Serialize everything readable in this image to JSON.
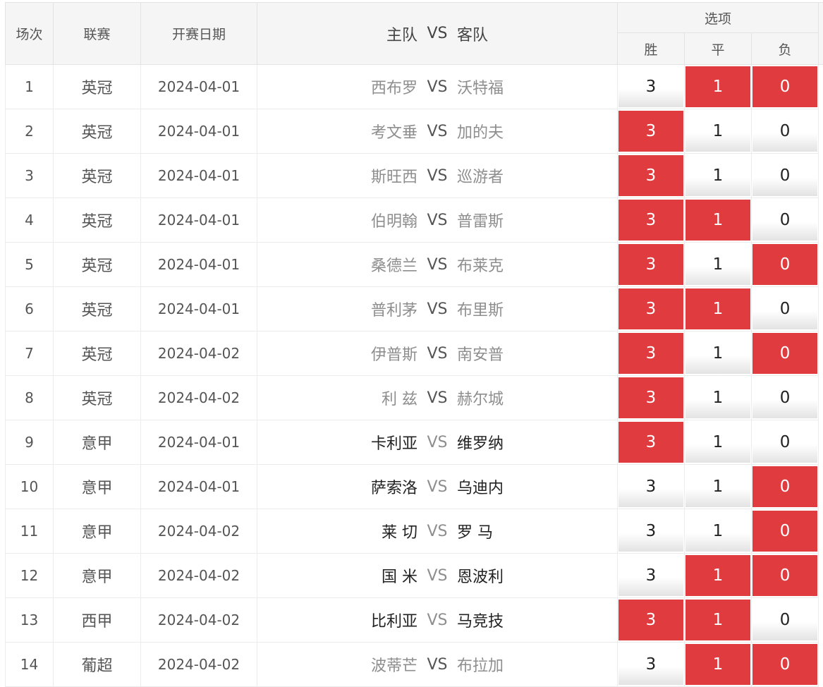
{
  "header": {
    "round": "场次",
    "league": "联赛",
    "date": "开赛日期",
    "home": "主队",
    "vs": "VS",
    "away": "客队",
    "options": "选项",
    "win": "胜",
    "draw": "平",
    "lose": "负"
  },
  "colors": {
    "selected": "#e03b3f",
    "muted_team": "#8e8e8e",
    "strong_team": "#222222"
  },
  "rows": [
    {
      "no": "1",
      "league": "英冠",
      "date": "2024-04-01",
      "home": "西布罗",
      "away": "沃特福",
      "home_style": "muted",
      "away_style": "muted",
      "win": "3",
      "draw": "1",
      "lose": "0",
      "win_sel": false,
      "draw_sel": true,
      "lose_sel": true
    },
    {
      "no": "2",
      "league": "英冠",
      "date": "2024-04-01",
      "home": "考文垂",
      "away": "加的夫",
      "home_style": "muted",
      "away_style": "muted",
      "win": "3",
      "draw": "1",
      "lose": "0",
      "win_sel": true,
      "draw_sel": false,
      "lose_sel": false
    },
    {
      "no": "3",
      "league": "英冠",
      "date": "2024-04-01",
      "home": "斯旺西",
      "away": "巡游者",
      "home_style": "muted",
      "away_style": "muted",
      "win": "3",
      "draw": "1",
      "lose": "0",
      "win_sel": true,
      "draw_sel": false,
      "lose_sel": false
    },
    {
      "no": "4",
      "league": "英冠",
      "date": "2024-04-01",
      "home": "伯明翰",
      "away": "普雷斯",
      "home_style": "muted",
      "away_style": "muted",
      "win": "3",
      "draw": "1",
      "lose": "0",
      "win_sel": true,
      "draw_sel": true,
      "lose_sel": false
    },
    {
      "no": "5",
      "league": "英冠",
      "date": "2024-04-01",
      "home": "桑德兰",
      "away": "布莱克",
      "home_style": "muted",
      "away_style": "muted",
      "win": "3",
      "draw": "1",
      "lose": "0",
      "win_sel": true,
      "draw_sel": false,
      "lose_sel": true
    },
    {
      "no": "6",
      "league": "英冠",
      "date": "2024-04-01",
      "home": "普利茅",
      "away": "布里斯",
      "home_style": "muted",
      "away_style": "muted",
      "win": "3",
      "draw": "1",
      "lose": "0",
      "win_sel": true,
      "draw_sel": true,
      "lose_sel": false
    },
    {
      "no": "7",
      "league": "英冠",
      "date": "2024-04-02",
      "home": "伊普斯",
      "away": "南安普",
      "home_style": "muted",
      "away_style": "muted",
      "win": "3",
      "draw": "1",
      "lose": "0",
      "win_sel": true,
      "draw_sel": false,
      "lose_sel": true
    },
    {
      "no": "8",
      "league": "英冠",
      "date": "2024-04-02",
      "home": "利 兹",
      "away": "赫尔城",
      "home_style": "muted",
      "away_style": "muted",
      "win": "3",
      "draw": "1",
      "lose": "0",
      "win_sel": true,
      "draw_sel": false,
      "lose_sel": false
    },
    {
      "no": "9",
      "league": "意甲",
      "date": "2024-04-01",
      "home": "卡利亚",
      "away": "维罗纳",
      "home_style": "strong",
      "away_style": "strong",
      "win": "3",
      "draw": "1",
      "lose": "0",
      "win_sel": true,
      "draw_sel": false,
      "lose_sel": false
    },
    {
      "no": "10",
      "league": "意甲",
      "date": "2024-04-01",
      "home": "萨索洛",
      "away": "乌迪内",
      "home_style": "strong",
      "away_style": "strong",
      "win": "3",
      "draw": "1",
      "lose": "0",
      "win_sel": false,
      "draw_sel": false,
      "lose_sel": true
    },
    {
      "no": "11",
      "league": "意甲",
      "date": "2024-04-02",
      "home": "莱 切",
      "away": "罗 马",
      "home_style": "strong",
      "away_style": "strong",
      "win": "3",
      "draw": "1",
      "lose": "0",
      "win_sel": false,
      "draw_sel": false,
      "lose_sel": true
    },
    {
      "no": "12",
      "league": "意甲",
      "date": "2024-04-02",
      "home": "国 米",
      "away": "恩波利",
      "home_style": "strong",
      "away_style": "strong",
      "win": "3",
      "draw": "1",
      "lose": "0",
      "win_sel": false,
      "draw_sel": true,
      "lose_sel": true
    },
    {
      "no": "13",
      "league": "西甲",
      "date": "2024-04-02",
      "home": "比利亚",
      "away": "马竞技",
      "home_style": "strong",
      "away_style": "strong",
      "win": "3",
      "draw": "1",
      "lose": "0",
      "win_sel": true,
      "draw_sel": true,
      "lose_sel": false
    },
    {
      "no": "14",
      "league": "葡超",
      "date": "2024-04-02",
      "home": "波蒂芒",
      "away": "布拉加",
      "home_style": "muted",
      "away_style": "muted",
      "win": "3",
      "draw": "1",
      "lose": "0",
      "win_sel": false,
      "draw_sel": true,
      "lose_sel": true
    }
  ]
}
